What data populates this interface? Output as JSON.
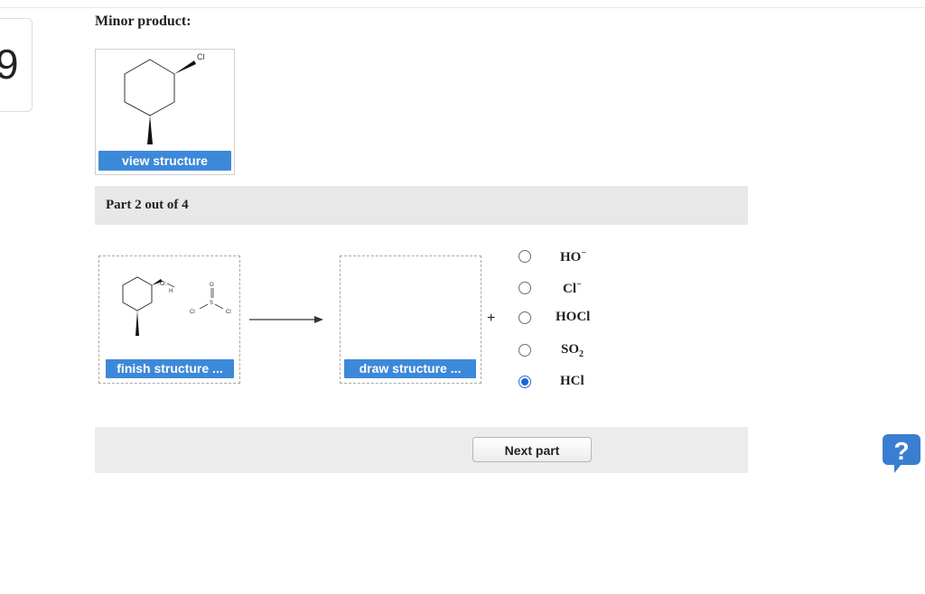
{
  "left_card": {
    "text": "9"
  },
  "minor_product": {
    "label": "Minor product:",
    "structure_atom": "Cl",
    "view_button": "view structure"
  },
  "part": {
    "text": "Part 2 out of 4"
  },
  "reaction": {
    "reactant_labels": {
      "o_atom": ":O:",
      "h_atom": "H",
      "s_atom": "S",
      "cl_left": "Cl",
      "cl_right": "Cl",
      "o_top": "O"
    },
    "finish_button": "finish structure ...",
    "draw_button": "draw structure ...",
    "plus": "+",
    "options": [
      {
        "base": "HO",
        "sup": "−",
        "sub": "",
        "checked": false
      },
      {
        "base": "Cl",
        "sup": "−",
        "sub": "",
        "checked": false
      },
      {
        "base": "HOCl",
        "sup": "",
        "sub": "",
        "checked": false
      },
      {
        "base": "SO",
        "sup": "",
        "sub": "2",
        "checked": false
      },
      {
        "base": "HCl",
        "sup": "",
        "sub": "",
        "checked": true
      }
    ]
  },
  "next_button": "Next part",
  "help_icon": {
    "glyph": "?",
    "color": "#3a7ed1"
  },
  "colors": {
    "button_blue": "#3d89d9",
    "bar_gray": "#e8e8e8",
    "radio_selected": "#1d64d8"
  }
}
